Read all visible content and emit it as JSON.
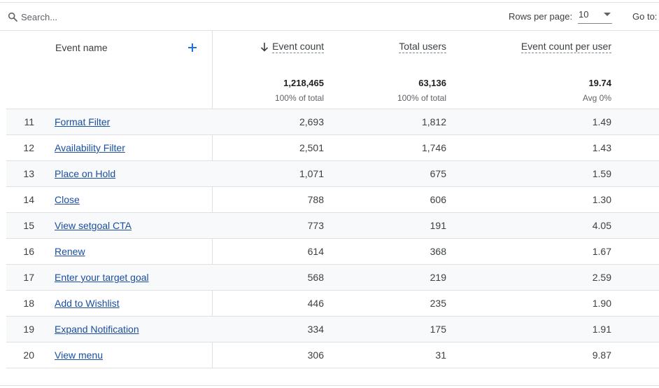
{
  "toolbar": {
    "search_placeholder": "Search...",
    "rows_per_page_label": "Rows per page:",
    "rows_per_page_value": "10",
    "goto_label": "Go to:"
  },
  "table": {
    "dimension_header": "Event name",
    "columns": [
      {
        "label": "Event count",
        "total": "1,218,465",
        "sub": "100% of total",
        "sorted": "descending"
      },
      {
        "label": "Total users",
        "total": "63,136",
        "sub": "100% of total"
      },
      {
        "label": "Event count per user",
        "total": "19.74",
        "sub": "Avg 0%"
      }
    ],
    "rows": [
      {
        "index": "11",
        "name": "Format Filter",
        "event_count": "2,693",
        "total_users": "1,812",
        "per_user": "1.49"
      },
      {
        "index": "12",
        "name": "Availability Filter",
        "event_count": "2,501",
        "total_users": "1,746",
        "per_user": "1.43"
      },
      {
        "index": "13",
        "name": "Place on Hold",
        "event_count": "1,071",
        "total_users": "675",
        "per_user": "1.59"
      },
      {
        "index": "14",
        "name": "Close",
        "event_count": "788",
        "total_users": "606",
        "per_user": "1.30"
      },
      {
        "index": "15",
        "name": "View setgoal CTA",
        "event_count": "773",
        "total_users": "191",
        "per_user": "4.05"
      },
      {
        "index": "16",
        "name": "Renew",
        "event_count": "614",
        "total_users": "368",
        "per_user": "1.67"
      },
      {
        "index": "17",
        "name": "Enter your target goal",
        "event_count": "568",
        "total_users": "219",
        "per_user": "2.59"
      },
      {
        "index": "18",
        "name": "Add to Wishlist",
        "event_count": "446",
        "total_users": "235",
        "per_user": "1.90"
      },
      {
        "index": "19",
        "name": "Expand Notification",
        "event_count": "334",
        "total_users": "175",
        "per_user": "1.91"
      },
      {
        "index": "20",
        "name": "View menu",
        "event_count": "306",
        "total_users": "31",
        "per_user": "9.87"
      }
    ]
  },
  "colors": {
    "link": "#1a4fa0",
    "accent": "#1a73e8",
    "row_shade": "#f8f9fa",
    "border": "#e0e0e0"
  }
}
